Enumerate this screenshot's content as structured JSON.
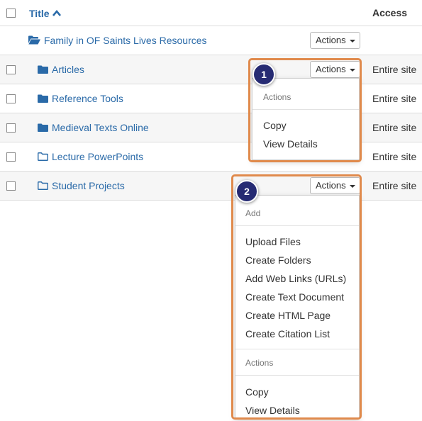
{
  "table": {
    "header": {
      "title_label": "Title",
      "access_label": "Access"
    },
    "rows": [
      {
        "name": "Family in OF Saints Lives Resources",
        "access": "",
        "icon": "folder-open-icon",
        "actions_label": "Actions"
      },
      {
        "name": "Articles",
        "access": "Entire site",
        "icon": "folder-icon",
        "actions_label": "Actions"
      },
      {
        "name": "Reference Tools",
        "access": "Entire site",
        "icon": "folder-icon"
      },
      {
        "name": "Medieval Texts Online",
        "access": "Entire site",
        "icon": "folder-icon"
      },
      {
        "name": "Lecture PowerPoints",
        "access": "Entire site",
        "icon": "folder-outline-icon"
      },
      {
        "name": "Student Projects",
        "access": "Entire site",
        "icon": "folder-outline-icon",
        "actions_label": "Actions"
      }
    ]
  },
  "menu1": {
    "badge": "1",
    "header": "Actions",
    "items": [
      "Copy",
      "View Details"
    ]
  },
  "menu2": {
    "badge": "2",
    "add_header": "Add",
    "add_items": [
      "Upload Files",
      "Create Folders",
      "Add Web Links (URLs)",
      "Create Text Document",
      "Create HTML Page",
      "Create Citation List"
    ],
    "actions_header": "Actions",
    "action_items": [
      "Copy",
      "View Details"
    ]
  },
  "colors": {
    "link": "#2a6aa8",
    "highlight": "#e08a4c",
    "badge": "#262b73",
    "row_alt": "#f6f6f6"
  }
}
